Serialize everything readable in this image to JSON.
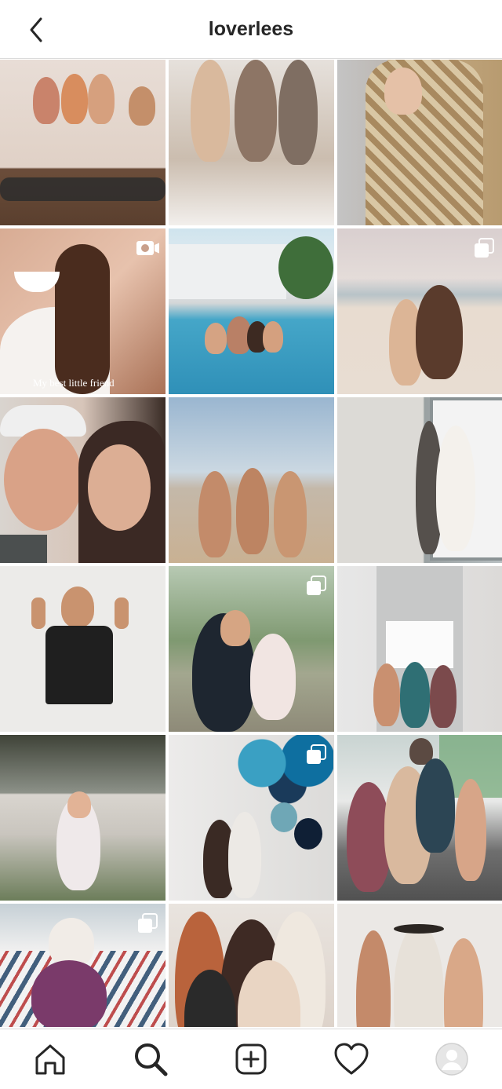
{
  "header": {
    "title": "loverlees"
  },
  "grid": {
    "tiles": [
      {
        "badge": "",
        "caption": ""
      },
      {
        "badge": "",
        "caption": ""
      },
      {
        "badge": "",
        "caption": ""
      },
      {
        "badge": "video-icon",
        "caption": "My best little friend"
      },
      {
        "badge": "",
        "caption": ""
      },
      {
        "badge": "carousel-icon",
        "caption": ""
      },
      {
        "badge": "",
        "caption": ""
      },
      {
        "badge": "",
        "caption": ""
      },
      {
        "badge": "",
        "caption": ""
      },
      {
        "badge": "",
        "caption": ""
      },
      {
        "badge": "carousel-icon",
        "caption": ""
      },
      {
        "badge": "",
        "caption": ""
      },
      {
        "badge": "",
        "caption": ""
      },
      {
        "badge": "carousel-icon",
        "caption": ""
      },
      {
        "badge": "",
        "caption": ""
      },
      {
        "badge": "carousel-icon",
        "caption": ""
      },
      {
        "badge": "",
        "caption": ""
      },
      {
        "badge": "",
        "caption": ""
      }
    ],
    "tile_colors": [
      "#a9826a",
      "#b9a898",
      "#c9b08b",
      "#d9b3a0",
      "#5ea5c4",
      "#d8cec4",
      "#d3c2b6",
      "#a9c0cf",
      "#d8d2cc",
      "#dcdad7",
      "#7e8f6a",
      "#d0d3d1",
      "#8d8d86",
      "#6f9fbd",
      "#8a8e86",
      "#b9aab0",
      "#b98a6e",
      "#c9bfb6"
    ]
  },
  "nav": {
    "items": [
      {
        "name": "home-icon"
      },
      {
        "name": "search-icon"
      },
      {
        "name": "new-post-icon"
      },
      {
        "name": "activity-heart-icon"
      },
      {
        "name": "profile-avatar"
      }
    ]
  },
  "colors": {
    "border": "#dbdbdb",
    "icon": "#262626",
    "background": "#ffffff"
  }
}
